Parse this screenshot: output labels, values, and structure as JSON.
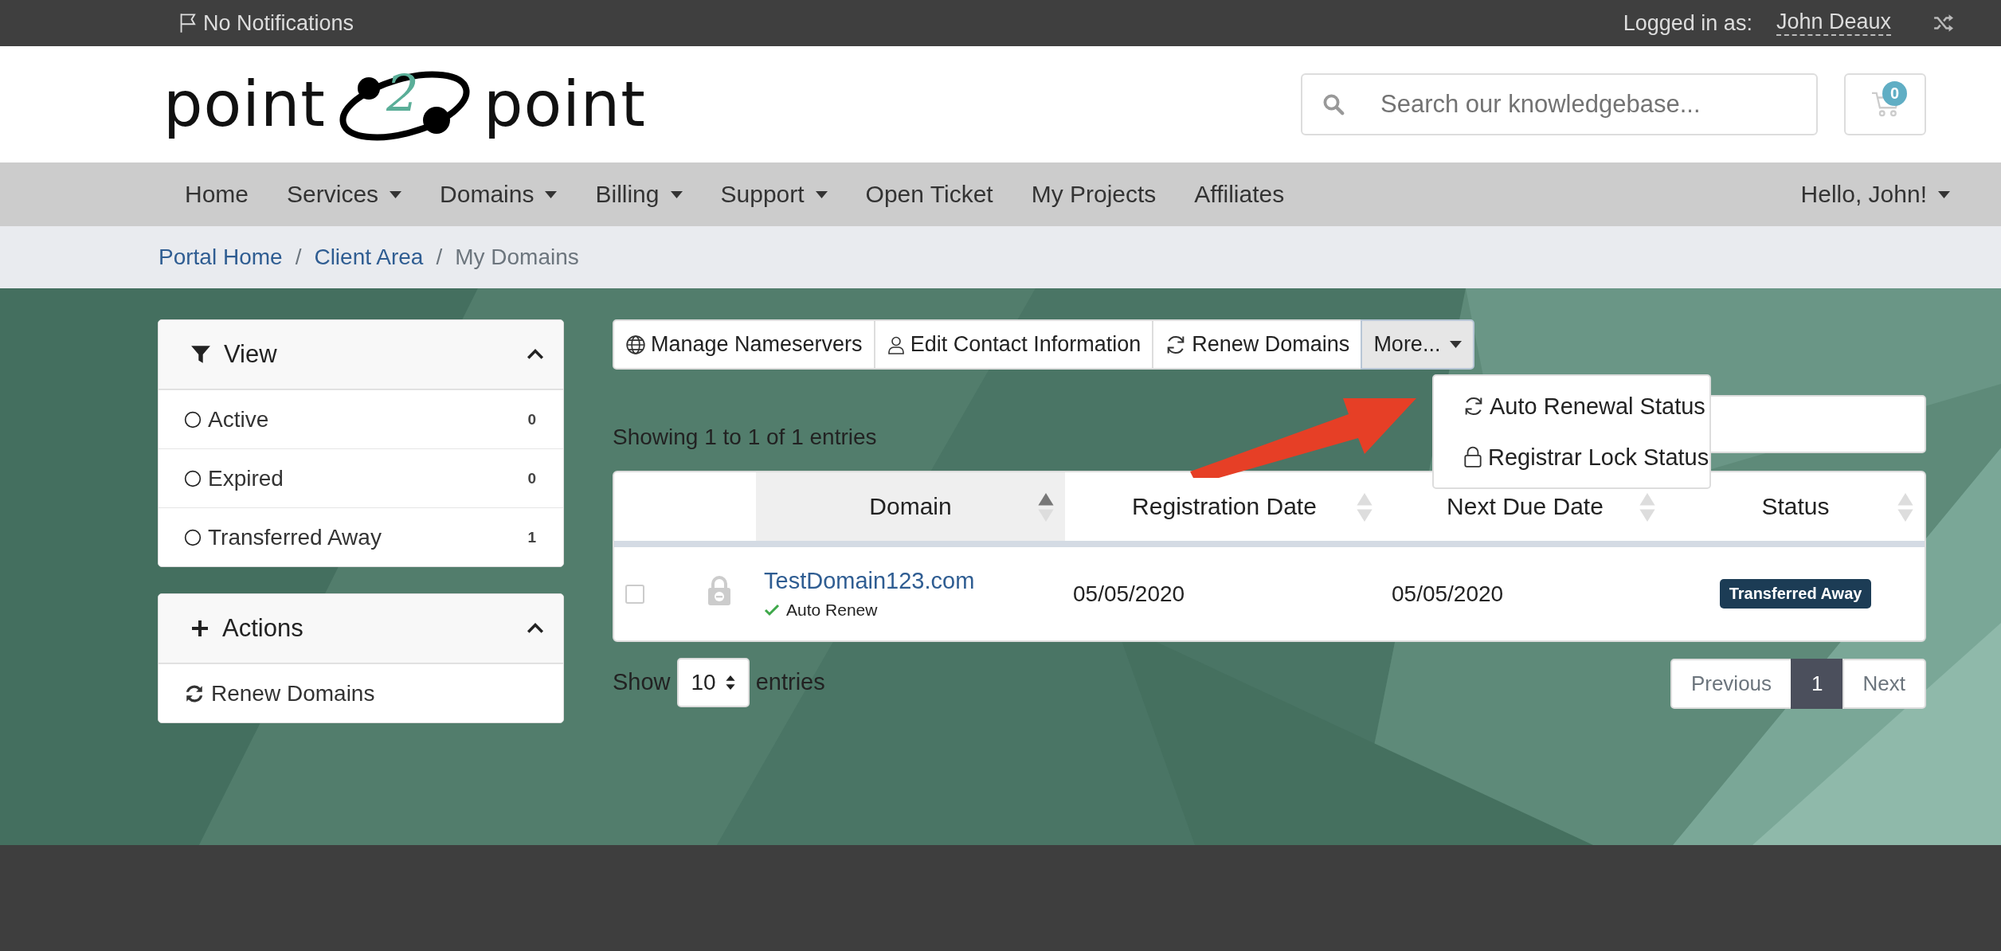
{
  "top_bar": {
    "notifications": "No Notifications",
    "logged_in_label": "Logged in as:",
    "user": "John Deaux"
  },
  "header": {
    "logo": {
      "left": "point",
      "middle": "2",
      "right": "point"
    },
    "search": {
      "placeholder": "Search our knowledgebase..."
    },
    "cart_count": "0"
  },
  "nav": {
    "items": [
      {
        "label": "Home",
        "dropdown": false
      },
      {
        "label": "Services",
        "dropdown": true
      },
      {
        "label": "Domains",
        "dropdown": true
      },
      {
        "label": "Billing",
        "dropdown": true
      },
      {
        "label": "Support",
        "dropdown": true
      },
      {
        "label": "Open Ticket",
        "dropdown": false
      },
      {
        "label": "My Projects",
        "dropdown": false
      },
      {
        "label": "Affiliates",
        "dropdown": false
      }
    ],
    "user_menu": {
      "label": "Hello, John!",
      "dropdown": true
    }
  },
  "breadcrumb": [
    {
      "kind": "link",
      "label": "Portal Home"
    },
    {
      "kind": "separator",
      "label": "/"
    },
    {
      "kind": "link",
      "label": "Client Area"
    },
    {
      "kind": "separator",
      "label": "/"
    },
    {
      "kind": "current",
      "label": "My Domains"
    }
  ],
  "sidebar": [
    {
      "title": "View",
      "expanded": true,
      "items": [
        {
          "kind": "radio",
          "label": "Active",
          "count": "0"
        },
        {
          "kind": "radio",
          "label": "Expired",
          "count": "0"
        },
        {
          "kind": "radio",
          "label": "Transferred Away",
          "count": "1"
        }
      ]
    },
    {
      "title": "Actions",
      "expanded": true,
      "items": [
        {
          "kind": "action",
          "label": "Renew Domains"
        }
      ]
    }
  ],
  "toolbar": {
    "buttons": [
      {
        "label": "Manage Nameservers"
      },
      {
        "label": "Edit Contact Information"
      },
      {
        "label": "Renew Domains"
      }
    ],
    "more": {
      "label": "More...",
      "expanded": true,
      "menu": [
        {
          "label": "Auto Renewal Status"
        },
        {
          "label": "Registrar Lock Status"
        }
      ]
    }
  },
  "table": {
    "info": "Showing 1 to 1 of 1 entries",
    "columns": [
      {
        "label": "Domain",
        "sorted": true
      },
      {
        "label": "Registration Date",
        "sorted": false
      },
      {
        "label": "Next Due Date",
        "sorted": false
      },
      {
        "label": "Status",
        "sorted": false
      }
    ],
    "rows": [
      {
        "checked": false,
        "locked": true,
        "domain": "TestDomain123.com",
        "auto_renew": "Auto Renew",
        "registration_date": "05/05/2020",
        "next_due_date": "05/05/2020",
        "status": "Transferred Away"
      }
    ],
    "length": {
      "before": "Show",
      "value": "10",
      "after": "entries"
    },
    "pagination": [
      {
        "label": "Previous",
        "selected": false
      },
      {
        "label": "1",
        "selected": true
      },
      {
        "label": "Next",
        "selected": false
      }
    ]
  }
}
